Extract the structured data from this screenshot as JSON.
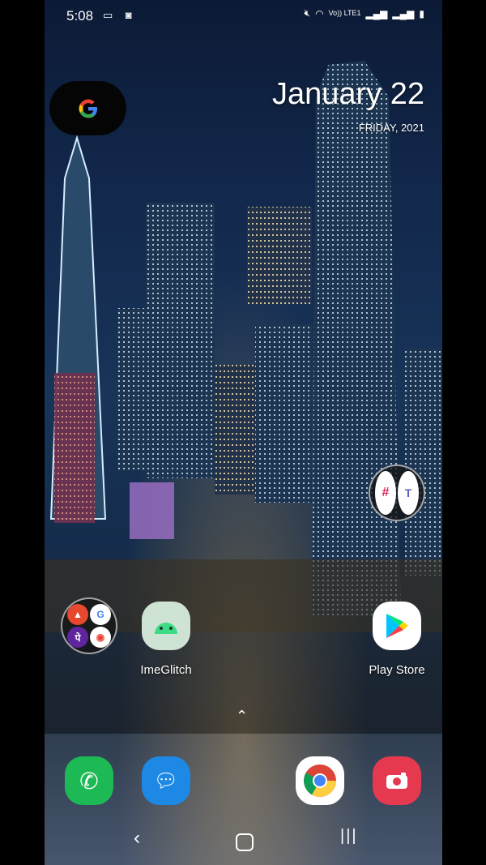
{
  "status_bar": {
    "time": "5:08",
    "network": "Vo)) LTE1"
  },
  "date_widget": {
    "date": "January 22",
    "day": "FRIDAY, 2021"
  },
  "apps": {
    "imeglitch": "ImeGlitch",
    "play_store": "Play Store"
  },
  "colors": {
    "phone_green": "#1db954",
    "messages_blue": "#1e88e5",
    "camera_red": "#e53950"
  }
}
